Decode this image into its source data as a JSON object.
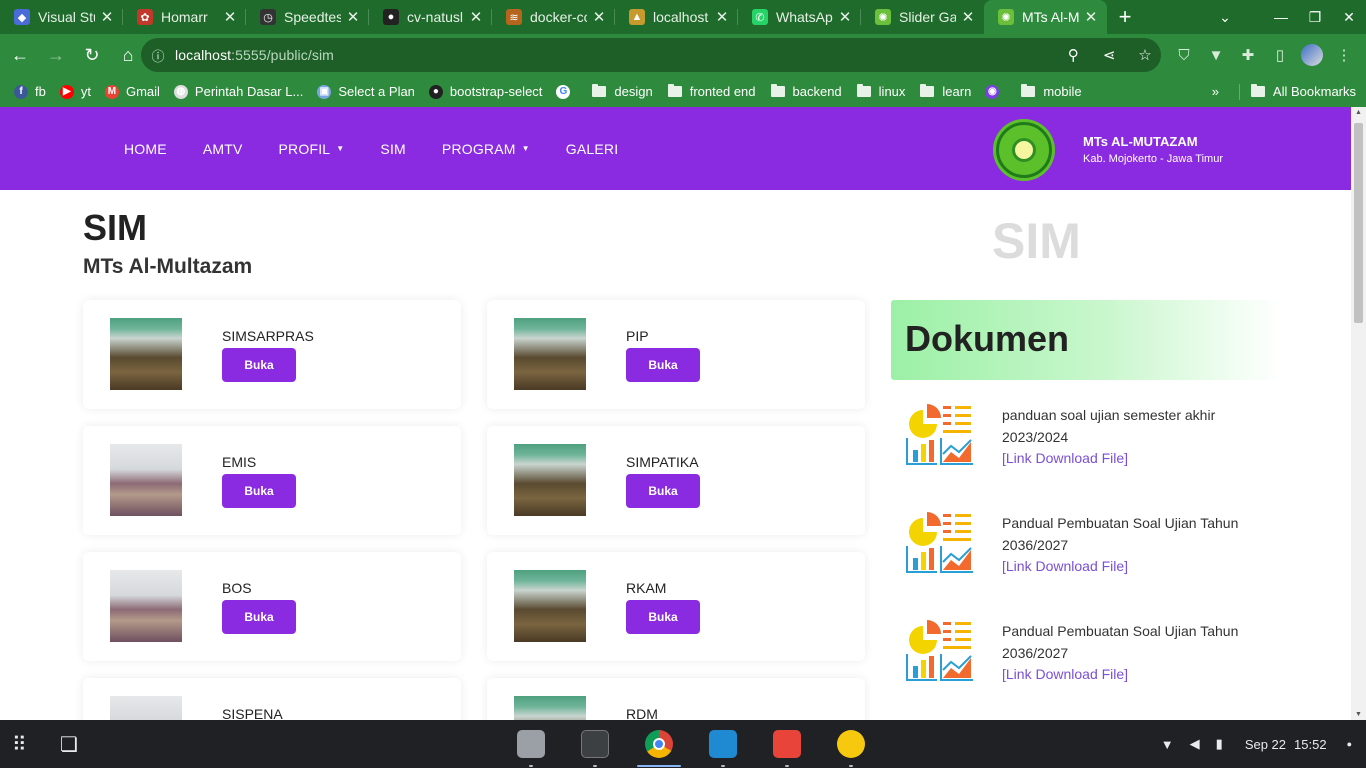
{
  "browser": {
    "tabs": [
      {
        "title": "Visual Stu",
        "color": "#4b6bd8",
        "glyph": "◆"
      },
      {
        "title": "Homarr",
        "color": "#c0392b",
        "glyph": "✿"
      },
      {
        "title": "Speedtes",
        "color": "#333333",
        "glyph": "◷"
      },
      {
        "title": "cv-natusl",
        "color": "#222222",
        "glyph": "●"
      },
      {
        "title": "docker-co",
        "color": "#b5651d",
        "glyph": "≋"
      },
      {
        "title": "localhost",
        "color": "#c79a2e",
        "glyph": "▲"
      },
      {
        "title": "WhatsApp",
        "color": "#25d366",
        "glyph": "✆"
      },
      {
        "title": "Slider Gan",
        "color": "#6bbf3b",
        "glyph": "✺"
      },
      {
        "title": "MTs Al-M",
        "color": "#6bbf3b",
        "glyph": "✺",
        "active": true
      }
    ],
    "close_glyph": "✕",
    "new_tab_glyph": "+",
    "url_host": "localhost",
    "url_rest": ":5555/public/sim",
    "bookmarks": [
      {
        "label": "fb",
        "icon": "facebook-icon",
        "color": "#3b5998",
        "glyph": "f"
      },
      {
        "label": "yt",
        "icon": "youtube-icon",
        "color": "#ff0000",
        "glyph": "▶"
      },
      {
        "label": "Gmail",
        "icon": "gmail-icon",
        "color": "#ea4335",
        "glyph": "M"
      },
      {
        "label": "Perintah Dasar L...",
        "icon": "globe-icon",
        "color": "#dddddd",
        "glyph": "◍"
      },
      {
        "label": "Select a Plan",
        "icon": "plan-icon",
        "color": "#7aa6e0",
        "glyph": "▣"
      },
      {
        "label": "bootstrap-select",
        "icon": "github-icon",
        "color": "#222222",
        "glyph": "●"
      },
      {
        "label": "",
        "icon": "google-icon",
        "color": "#ffffff",
        "glyph": "G"
      },
      {
        "label": "design",
        "icon": "folder-icon"
      },
      {
        "label": "fronted end",
        "icon": "folder-icon"
      },
      {
        "label": "backend",
        "icon": "folder-icon"
      },
      {
        "label": "linux",
        "icon": "folder-icon"
      },
      {
        "label": "learn",
        "icon": "folder-icon"
      },
      {
        "label": "",
        "icon": "extension-icon",
        "color": "#7b3fe4",
        "glyph": "◉"
      },
      {
        "label": "mobile",
        "icon": "folder-icon"
      }
    ],
    "all_bookmarks": "All Bookmarks"
  },
  "site": {
    "menu": [
      {
        "label": "HOME",
        "caret": false
      },
      {
        "label": "AMTV",
        "caret": false
      },
      {
        "label": "PROFIL",
        "caret": true
      },
      {
        "label": "SIM",
        "caret": false
      },
      {
        "label": "PROGRAM",
        "caret": true
      },
      {
        "label": "GALERI",
        "caret": false
      }
    ],
    "brand_title": "MTs AL-MUTAZAM",
    "brand_subtitle": "Kab. Mojokerto - Jawa Timur",
    "page_title": "SIM",
    "page_subtitle": "MTs Al-Multazam",
    "watermark": "SIM",
    "button_label": "Buka",
    "systems": [
      {
        "name": "SIMSARPRAS",
        "photo": "group-photo"
      },
      {
        "name": "PIP",
        "photo": "group-photo"
      },
      {
        "name": "EMIS",
        "photo": "hall-photo"
      },
      {
        "name": "SIMPATIKA",
        "photo": "group-photo"
      },
      {
        "name": "BOS",
        "photo": "hall-photo"
      },
      {
        "name": "RKAM",
        "photo": "group-photo"
      },
      {
        "name": "SISPENA",
        "photo": "hall-photo"
      },
      {
        "name": "RDM",
        "photo": "group-photo"
      }
    ],
    "documents_heading": "Dokumen",
    "documents": [
      {
        "title": "panduan soal ujian semester akhir 2023/2024",
        "link": "[Link Download File]"
      },
      {
        "title": "Pandual Pembuatan Soal Ujian Tahun 2036/2027",
        "link": "[Link Download File]"
      },
      {
        "title": "Pandual Pembuatan Soal Ujian Tahun 2036/2027",
        "link": "[Link Download File]"
      }
    ]
  },
  "taskbar": {
    "date": "Sep 22",
    "time": "15:52",
    "apps": [
      "files-icon",
      "terminal-icon",
      "chrome-icon",
      "vscode-icon",
      "wps-icon",
      "app-icon"
    ]
  },
  "colors": {
    "nav_purple": "#8a2be2",
    "chrome_green": "#2e8b3e",
    "link_purple": "#7b4fd6"
  }
}
